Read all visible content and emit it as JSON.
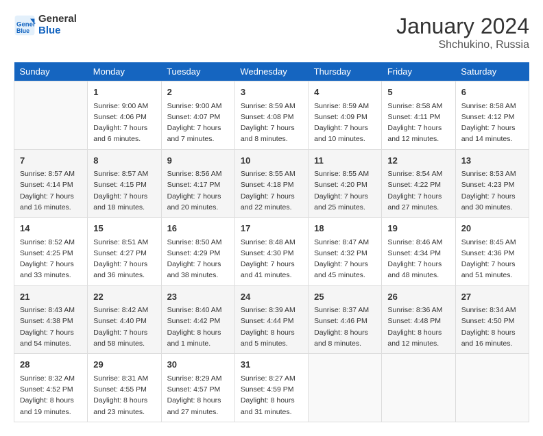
{
  "header": {
    "logo_line1": "General",
    "logo_line2": "Blue",
    "month": "January 2024",
    "location": "Shchukino, Russia"
  },
  "weekdays": [
    "Sunday",
    "Monday",
    "Tuesday",
    "Wednesday",
    "Thursday",
    "Friday",
    "Saturday"
  ],
  "weeks": [
    [
      {
        "day": "",
        "info": ""
      },
      {
        "day": "1",
        "info": "Sunrise: 9:00 AM\nSunset: 4:06 PM\nDaylight: 7 hours\nand 6 minutes."
      },
      {
        "day": "2",
        "info": "Sunrise: 9:00 AM\nSunset: 4:07 PM\nDaylight: 7 hours\nand 7 minutes."
      },
      {
        "day": "3",
        "info": "Sunrise: 8:59 AM\nSunset: 4:08 PM\nDaylight: 7 hours\nand 8 minutes."
      },
      {
        "day": "4",
        "info": "Sunrise: 8:59 AM\nSunset: 4:09 PM\nDaylight: 7 hours\nand 10 minutes."
      },
      {
        "day": "5",
        "info": "Sunrise: 8:58 AM\nSunset: 4:11 PM\nDaylight: 7 hours\nand 12 minutes."
      },
      {
        "day": "6",
        "info": "Sunrise: 8:58 AM\nSunset: 4:12 PM\nDaylight: 7 hours\nand 14 minutes."
      }
    ],
    [
      {
        "day": "7",
        "info": "Sunrise: 8:57 AM\nSunset: 4:14 PM\nDaylight: 7 hours\nand 16 minutes."
      },
      {
        "day": "8",
        "info": "Sunrise: 8:57 AM\nSunset: 4:15 PM\nDaylight: 7 hours\nand 18 minutes."
      },
      {
        "day": "9",
        "info": "Sunrise: 8:56 AM\nSunset: 4:17 PM\nDaylight: 7 hours\nand 20 minutes."
      },
      {
        "day": "10",
        "info": "Sunrise: 8:55 AM\nSunset: 4:18 PM\nDaylight: 7 hours\nand 22 minutes."
      },
      {
        "day": "11",
        "info": "Sunrise: 8:55 AM\nSunset: 4:20 PM\nDaylight: 7 hours\nand 25 minutes."
      },
      {
        "day": "12",
        "info": "Sunrise: 8:54 AM\nSunset: 4:22 PM\nDaylight: 7 hours\nand 27 minutes."
      },
      {
        "day": "13",
        "info": "Sunrise: 8:53 AM\nSunset: 4:23 PM\nDaylight: 7 hours\nand 30 minutes."
      }
    ],
    [
      {
        "day": "14",
        "info": "Sunrise: 8:52 AM\nSunset: 4:25 PM\nDaylight: 7 hours\nand 33 minutes."
      },
      {
        "day": "15",
        "info": "Sunrise: 8:51 AM\nSunset: 4:27 PM\nDaylight: 7 hours\nand 36 minutes."
      },
      {
        "day": "16",
        "info": "Sunrise: 8:50 AM\nSunset: 4:29 PM\nDaylight: 7 hours\nand 38 minutes."
      },
      {
        "day": "17",
        "info": "Sunrise: 8:48 AM\nSunset: 4:30 PM\nDaylight: 7 hours\nand 41 minutes."
      },
      {
        "day": "18",
        "info": "Sunrise: 8:47 AM\nSunset: 4:32 PM\nDaylight: 7 hours\nand 45 minutes."
      },
      {
        "day": "19",
        "info": "Sunrise: 8:46 AM\nSunset: 4:34 PM\nDaylight: 7 hours\nand 48 minutes."
      },
      {
        "day": "20",
        "info": "Sunrise: 8:45 AM\nSunset: 4:36 PM\nDaylight: 7 hours\nand 51 minutes."
      }
    ],
    [
      {
        "day": "21",
        "info": "Sunrise: 8:43 AM\nSunset: 4:38 PM\nDaylight: 7 hours\nand 54 minutes."
      },
      {
        "day": "22",
        "info": "Sunrise: 8:42 AM\nSunset: 4:40 PM\nDaylight: 7 hours\nand 58 minutes."
      },
      {
        "day": "23",
        "info": "Sunrise: 8:40 AM\nSunset: 4:42 PM\nDaylight: 8 hours\nand 1 minute."
      },
      {
        "day": "24",
        "info": "Sunrise: 8:39 AM\nSunset: 4:44 PM\nDaylight: 8 hours\nand 5 minutes."
      },
      {
        "day": "25",
        "info": "Sunrise: 8:37 AM\nSunset: 4:46 PM\nDaylight: 8 hours\nand 8 minutes."
      },
      {
        "day": "26",
        "info": "Sunrise: 8:36 AM\nSunset: 4:48 PM\nDaylight: 8 hours\nand 12 minutes."
      },
      {
        "day": "27",
        "info": "Sunrise: 8:34 AM\nSunset: 4:50 PM\nDaylight: 8 hours\nand 16 minutes."
      }
    ],
    [
      {
        "day": "28",
        "info": "Sunrise: 8:32 AM\nSunset: 4:52 PM\nDaylight: 8 hours\nand 19 minutes."
      },
      {
        "day": "29",
        "info": "Sunrise: 8:31 AM\nSunset: 4:55 PM\nDaylight: 8 hours\nand 23 minutes."
      },
      {
        "day": "30",
        "info": "Sunrise: 8:29 AM\nSunset: 4:57 PM\nDaylight: 8 hours\nand 27 minutes."
      },
      {
        "day": "31",
        "info": "Sunrise: 8:27 AM\nSunset: 4:59 PM\nDaylight: 8 hours\nand 31 minutes."
      },
      {
        "day": "",
        "info": ""
      },
      {
        "day": "",
        "info": ""
      },
      {
        "day": "",
        "info": ""
      }
    ]
  ]
}
